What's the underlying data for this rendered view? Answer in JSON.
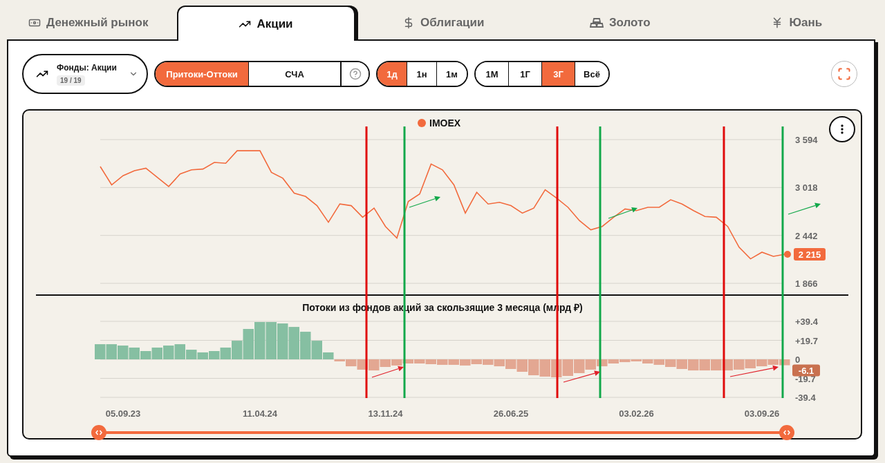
{
  "tabs": [
    {
      "label": "Денежный рынок",
      "selected": false
    },
    {
      "label": "Акции",
      "selected": true
    },
    {
      "label": "Облигации",
      "selected": false
    },
    {
      "label": "Золото",
      "selected": false
    },
    {
      "label": "Юань",
      "selected": false
    }
  ],
  "fund_selector": {
    "title": "Фонды: Акции",
    "count": "19 / 19"
  },
  "modes": [
    {
      "label": "Притоки-Оттоки",
      "selected": true
    },
    {
      "label": "СЧА",
      "selected": false
    }
  ],
  "intervals": [
    {
      "label": "1д",
      "selected": true
    },
    {
      "label": "1н",
      "selected": false
    },
    {
      "label": "1м",
      "selected": false
    }
  ],
  "periods": [
    {
      "label": "1М",
      "selected": false
    },
    {
      "label": "1Г",
      "selected": false
    },
    {
      "label": "3Г",
      "selected": true
    },
    {
      "label": "Всё",
      "selected": false
    }
  ],
  "price_chart": {
    "current_value": "2 215",
    "chart_data": {
      "type": "line",
      "series": [
        {
          "name": "IMOEX",
          "color": "#f26a3d",
          "values": [
            3270,
            3050,
            3160,
            3220,
            3250,
            3140,
            3030,
            3180,
            3230,
            3240,
            3320,
            3310,
            3460,
            3460,
            3460,
            3200,
            3130,
            2950,
            2910,
            2800,
            2600,
            2820,
            2800,
            2660,
            2770,
            2550,
            2410,
            2850,
            2940,
            3300,
            3230,
            3050,
            2710,
            2960,
            2820,
            2840,
            2800,
            2710,
            2770,
            2990,
            2890,
            2780,
            2620,
            2510,
            2550,
            2660,
            2760,
            2740,
            2780,
            2780,
            2870,
            2820,
            2740,
            2670,
            2660,
            2550,
            2300,
            2160,
            2240,
            2190,
            2215
          ]
        }
      ],
      "grid": true,
      "ylim": [
        1866,
        3594
      ],
      "yticks": [
        {
          "value": 3594,
          "label": "3 594"
        },
        {
          "value": 3018,
          "label": "3 018"
        },
        {
          "value": 2442,
          "label": "2 442"
        },
        {
          "value": 1866,
          "label": "1 866"
        }
      ]
    }
  },
  "flows_chart": {
    "current_value": "-6.1",
    "chart_data": {
      "type": "bar",
      "title": "Потоки из фондов акций за скользящие 3 месяца (млрд ₽)",
      "categories": [
        null,
        null,
        "05.09.23",
        null,
        null,
        null,
        null,
        null,
        null,
        null,
        null,
        null,
        null,
        null,
        "11.04.24",
        null,
        null,
        null,
        null,
        null,
        null,
        null,
        null,
        null,
        null,
        "13.11.24",
        null,
        null,
        null,
        null,
        null,
        null,
        null,
        null,
        null,
        null,
        "26.06.25",
        null,
        null,
        null,
        null,
        null,
        null,
        null,
        null,
        null,
        null,
        "03.02.26",
        null,
        null,
        null,
        null,
        null,
        null,
        null,
        null,
        null,
        null,
        "03.09.26",
        null,
        null
      ],
      "series": [
        {
          "values": [
            15.7,
            15.7,
            14.3,
            12.2,
            8.6,
            12.2,
            14.3,
            15.7,
            10,
            7.2,
            8.6,
            12.2,
            19.3,
            31.5,
            38.7,
            38.7,
            37.2,
            33.6,
            28.6,
            19.3,
            7.2,
            -2.1,
            -7.2,
            -10.7,
            -11.5,
            -7.9,
            -6.4,
            -4.3,
            -4.3,
            -5,
            -5.7,
            -5.7,
            -6.4,
            -5,
            -5.7,
            -7.2,
            -10,
            -12.9,
            -16.5,
            -17.9,
            -18.6,
            -17.2,
            -14.3,
            -10.7,
            -7.2,
            -4.3,
            -2.9,
            -2.1,
            -4.3,
            -5.7,
            -7.9,
            -10,
            -11.5,
            -11.5,
            -11.5,
            -11.5,
            -10.7,
            -9.3,
            -7.2,
            -5.7,
            -6.1
          ]
        }
      ],
      "grid": true,
      "ylim": [
        -39.4,
        39.4
      ],
      "yticks": [
        {
          "value": 39.4,
          "label": "+39.4"
        },
        {
          "value": 19.7,
          "label": "+19.7"
        },
        {
          "value": 0,
          "label": "0"
        },
        {
          "value": -19.7,
          "label": "-19.7"
        },
        {
          "value": -39.4,
          "label": "-39.4"
        }
      ]
    }
  },
  "markers": [
    {
      "color": "#e00b0b"
    },
    {
      "color": "#12a84a"
    },
    {
      "color": "#e00b0b"
    },
    {
      "color": "#12a84a"
    },
    {
      "color": "#e00b0b"
    },
    {
      "color": "#12a84a"
    }
  ],
  "range_handles": [
    {
      "level": 0
    },
    {
      "level": 1
    }
  ]
}
